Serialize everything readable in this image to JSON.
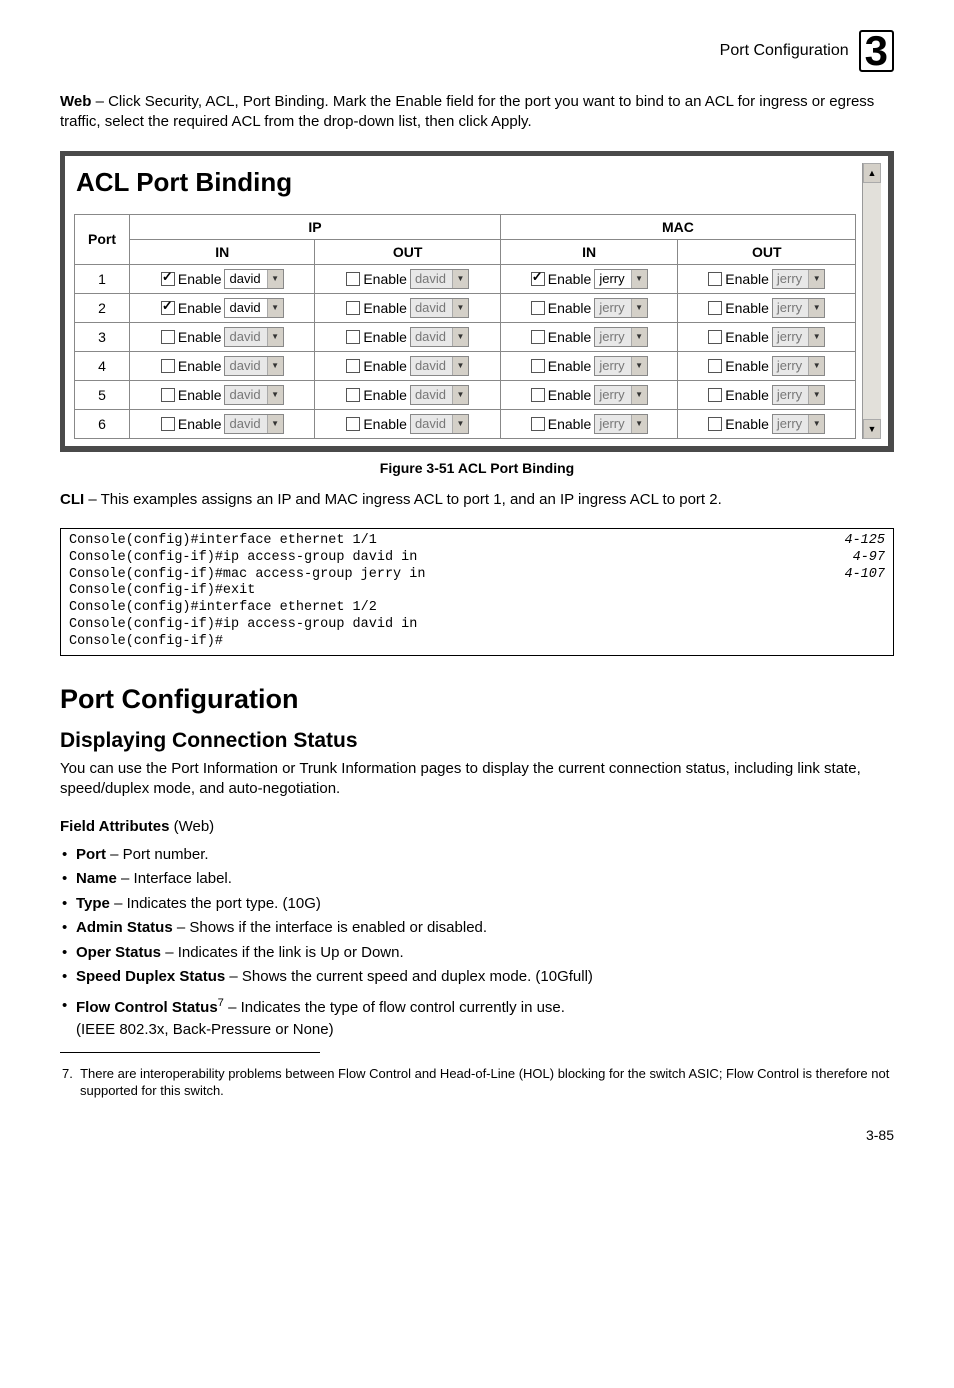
{
  "header": {
    "title": "Port Configuration",
    "chapter": "3"
  },
  "intro_web": {
    "lead": "Web",
    "text": " – Click Security, ACL, Port Binding. Mark the Enable field for the port you want to bind to an ACL for ingress or egress traffic, select the required ACL from the drop-down list, then click Apply."
  },
  "figure": {
    "title": "ACL Port Binding",
    "col_port": "Port",
    "col_ip": "IP",
    "col_mac": "MAC",
    "col_in": "IN",
    "col_out": "OUT",
    "enable": "Enable",
    "ip_name": "david",
    "mac_name": "jerry",
    "caption": "Figure 3-51   ACL Port Binding",
    "rows": [
      {
        "port": "1",
        "ip_in_chk": true,
        "ip_in_sel": true,
        "mac_in_chk": true,
        "mac_in_sel": true
      },
      {
        "port": "2",
        "ip_in_chk": true,
        "ip_in_sel": true,
        "mac_in_chk": false,
        "mac_in_sel": false
      },
      {
        "port": "3",
        "ip_in_chk": false,
        "ip_in_sel": false,
        "mac_in_chk": false,
        "mac_in_sel": false
      },
      {
        "port": "4",
        "ip_in_chk": false,
        "ip_in_sel": false,
        "mac_in_chk": false,
        "mac_in_sel": false
      },
      {
        "port": "5",
        "ip_in_chk": false,
        "ip_in_sel": false,
        "mac_in_chk": false,
        "mac_in_sel": false
      },
      {
        "port": "6",
        "ip_in_chk": false,
        "ip_in_sel": false,
        "mac_in_chk": false,
        "mac_in_sel": false
      }
    ]
  },
  "cli": {
    "lead": "CLI",
    "text": " – This examples assigns an IP and MAC ingress ACL to port 1, and an IP ingress ACL to port 2.",
    "lines": [
      {
        "cmd": "Console(config)#interface ethernet 1/1",
        "ref": "4-125"
      },
      {
        "cmd": "Console(config-if)#ip access-group david in",
        "ref": "4-97"
      },
      {
        "cmd": "Console(config-if)#mac access-group jerry in",
        "ref": "4-107"
      },
      {
        "cmd": "Console(config-if)#exit",
        "ref": ""
      },
      {
        "cmd": "Console(config)#interface ethernet 1/2",
        "ref": ""
      },
      {
        "cmd": "Console(config-if)#ip access-group david in",
        "ref": ""
      },
      {
        "cmd": "Console(config-if)#",
        "ref": ""
      }
    ]
  },
  "section": {
    "h1": "Port Configuration",
    "h2": "Displaying Connection Status",
    "para": "You can use the Port Information or Trunk Information pages to display the current connection status, including link state, speed/duplex mode, and auto-negotiation.",
    "fa_lead": "Field Attributes",
    "fa_tail": " (Web)",
    "bullets": [
      {
        "b": "Port",
        "t": " – Port number."
      },
      {
        "b": "Name",
        "t": " – Interface label."
      },
      {
        "b": "Type",
        "t": " – Indicates the port type. (10G)"
      },
      {
        "b": "Admin Status",
        "t": " – Shows if the interface is enabled or disabled."
      },
      {
        "b": "Oper Status",
        "t": " – Indicates if the link is Up or Down."
      },
      {
        "b": "Speed Duplex Status",
        "t": " – Shows the current speed and duplex mode. (10Gfull)"
      }
    ],
    "last_bullet_b": "Flow Control Status",
    "last_bullet_sup": "7",
    "last_bullet_t1": " – Indicates the type of flow control currently in use.",
    "last_bullet_t2": "(IEEE 802.3x, Back-Pressure or None)"
  },
  "footnote": {
    "num": "7.",
    "text": "There are interoperability problems between Flow Control and Head-of-Line (HOL) blocking for the switch ASIC; Flow Control is therefore not supported for this switch."
  },
  "page_num": "3-85"
}
